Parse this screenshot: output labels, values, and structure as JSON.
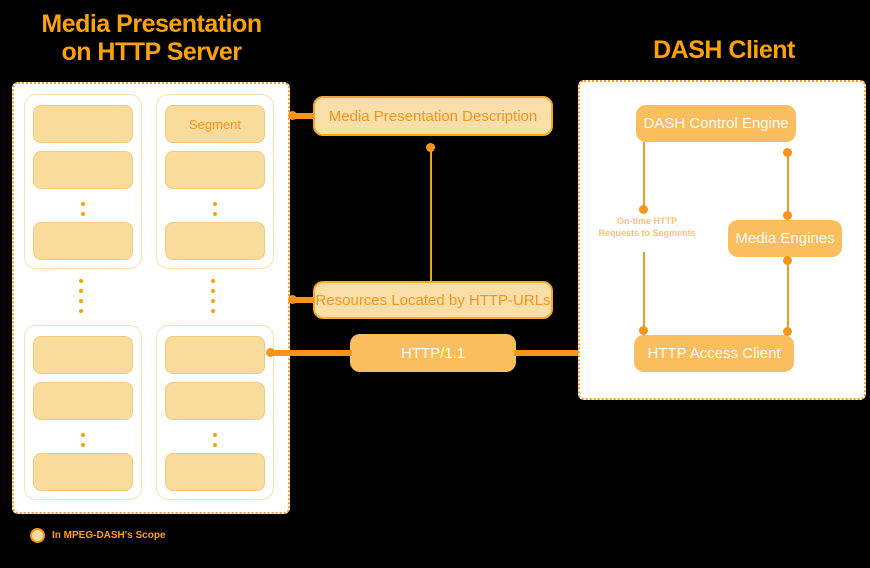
{
  "server": {
    "title": "Media Presentation\non HTTP Server",
    "periods": [
      {
        "columns": [
          {
            "segments": [
              "",
              ""
            ],
            "tail_segment": ""
          },
          {
            "segments": [
              "Segment",
              ""
            ],
            "tail_segment": ""
          }
        ]
      },
      {
        "columns": [
          {
            "segments": [
              "",
              ""
            ],
            "tail_segment": ""
          },
          {
            "segments": [
              "",
              ""
            ],
            "tail_segment": ""
          }
        ]
      }
    ]
  },
  "middle": {
    "mpd_label": "Media Presentation Description",
    "resources_label": "Resources Located by HTTP-URLs",
    "http_label": "HTTP/1.1"
  },
  "client": {
    "title": "DASH Client",
    "control_engine_label": "DASH Control Engine",
    "media_engines_label": "Media Engines",
    "access_client_label": "HTTP Access Client",
    "note": "On-time HTTP\nRequests to Segments"
  },
  "legend": {
    "label": "In MPEG-DASH's Scope"
  },
  "colors": {
    "background": "#000000",
    "panel_fill": "#FFFFFF",
    "accent": "#F7941D",
    "title": "#FBA208",
    "segment_fill": "#F9DB9B",
    "segment_border": "#F5C97B",
    "solid_box": "#FBBE5E",
    "light_box": "#FBDFA8",
    "note_text": "#FBC26B"
  }
}
